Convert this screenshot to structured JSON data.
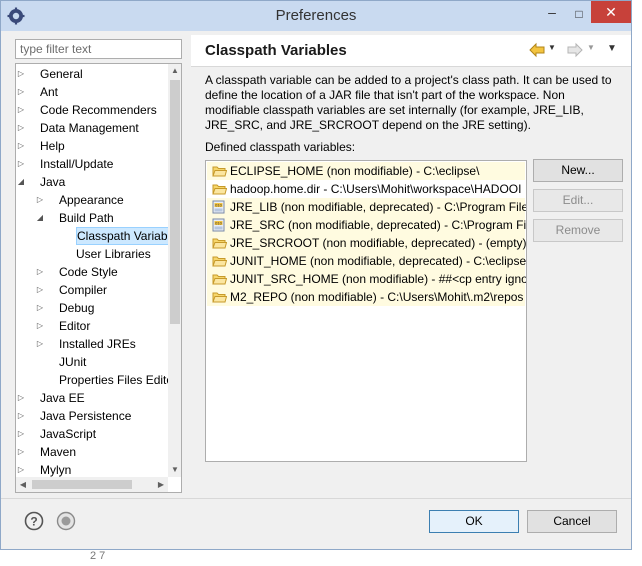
{
  "window": {
    "title": "Preferences",
    "min_glyph": "–",
    "max_glyph": "□",
    "close_glyph": "✕"
  },
  "filter": {
    "placeholder": "type filter text"
  },
  "tree": [
    {
      "label": "General",
      "depth": 0,
      "arrow": "collapsed"
    },
    {
      "label": "Ant",
      "depth": 0,
      "arrow": "collapsed"
    },
    {
      "label": "Code Recommenders",
      "depth": 0,
      "arrow": "collapsed"
    },
    {
      "label": "Data Management",
      "depth": 0,
      "arrow": "collapsed"
    },
    {
      "label": "Help",
      "depth": 0,
      "arrow": "collapsed"
    },
    {
      "label": "Install/Update",
      "depth": 0,
      "arrow": "collapsed"
    },
    {
      "label": "Java",
      "depth": 0,
      "arrow": "expanded"
    },
    {
      "label": "Appearance",
      "depth": 1,
      "arrow": "collapsed"
    },
    {
      "label": "Build Path",
      "depth": 1,
      "arrow": "expanded"
    },
    {
      "label": "Classpath Variab",
      "depth": 2,
      "arrow": "none",
      "selected": true
    },
    {
      "label": "User Libraries",
      "depth": 2,
      "arrow": "none"
    },
    {
      "label": "Code Style",
      "depth": 1,
      "arrow": "collapsed"
    },
    {
      "label": "Compiler",
      "depth": 1,
      "arrow": "collapsed"
    },
    {
      "label": "Debug",
      "depth": 1,
      "arrow": "collapsed"
    },
    {
      "label": "Editor",
      "depth": 1,
      "arrow": "collapsed"
    },
    {
      "label": "Installed JREs",
      "depth": 1,
      "arrow": "collapsed"
    },
    {
      "label": "JUnit",
      "depth": 1,
      "arrow": "none"
    },
    {
      "label": "Properties Files Edito",
      "depth": 1,
      "arrow": "none"
    },
    {
      "label": "Java EE",
      "depth": 0,
      "arrow": "collapsed"
    },
    {
      "label": "Java Persistence",
      "depth": 0,
      "arrow": "collapsed"
    },
    {
      "label": "JavaScript",
      "depth": 0,
      "arrow": "collapsed"
    },
    {
      "label": "Maven",
      "depth": 0,
      "arrow": "collapsed"
    },
    {
      "label": "Mylyn",
      "depth": 0,
      "arrow": "collapsed"
    }
  ],
  "page": {
    "title": "Classpath Variables",
    "description": "A classpath variable can be added to a project's class path. It can be used to define the location of a JAR file that isn't part of the workspace. Non modifiable classpath variables are set internally (for example, JRE_LIB, JRE_SRC, and JRE_SRCROOT depend on the JRE setting).",
    "defined_label": "Defined classpath variables:"
  },
  "variables": [
    {
      "text": "ECLIPSE_HOME (non modifiable) - C:\\eclipse\\",
      "icon": "folder-icon",
      "readonly": true
    },
    {
      "text": "hadoop.home.dir - C:\\Users\\Mohit\\workspace\\HADOOI",
      "icon": "folder-icon",
      "readonly": false
    },
    {
      "text": "JRE_LIB (non modifiable, deprecated) - C:\\Program Files'",
      "icon": "jar-icon",
      "readonly": true
    },
    {
      "text": "JRE_SRC (non modifiable, deprecated) - C:\\Program File",
      "icon": "jar-icon",
      "readonly": true
    },
    {
      "text": "JRE_SRCROOT (non modifiable, deprecated) - (empty)",
      "icon": "folder-icon",
      "readonly": true
    },
    {
      "text": "JUNIT_HOME (non modifiable, deprecated) - C:\\eclipse\\",
      "icon": "folder-icon",
      "readonly": true
    },
    {
      "text": "JUNIT_SRC_HOME (non modifiable) - ##<cp entry ignor",
      "icon": "folder-icon",
      "readonly": true
    },
    {
      "text": "M2_REPO (non modifiable) - C:\\Users\\Mohit\\.m2\\repos",
      "icon": "folder-icon",
      "readonly": true
    }
  ],
  "buttons": {
    "new": "New...",
    "edit": "Edit...",
    "remove": "Remove",
    "ok": "OK",
    "cancel": "Cancel"
  },
  "icons": {
    "title": "eclipse-preferences-icon",
    "help": "help-icon",
    "record": "record-icon",
    "back": "back-arrow-icon",
    "forward": "forward-arrow-icon"
  },
  "behind_text": "2 7"
}
